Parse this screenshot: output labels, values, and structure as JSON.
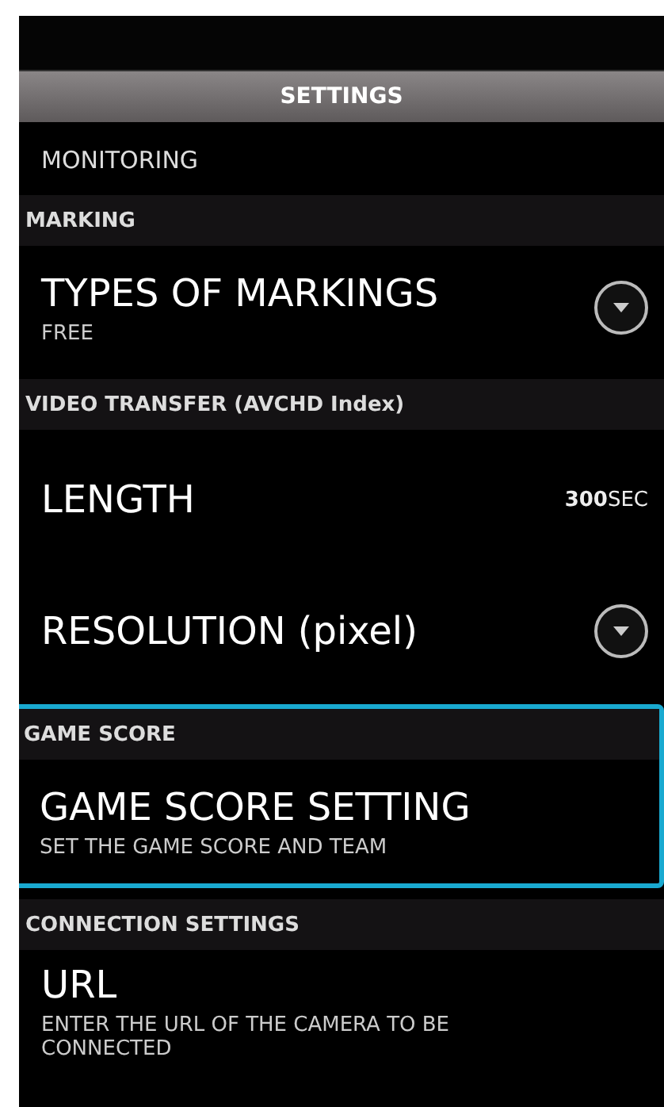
{
  "header": {
    "title": "SETTINGS"
  },
  "overflow_text": "MONITORING",
  "sections": [
    {
      "title": "MARKING",
      "highlighted": false,
      "items": [
        {
          "kind": "dropdown",
          "label": "TYPES OF MARKINGS",
          "subtitle": "FREE"
        }
      ]
    },
    {
      "title": "VIDEO TRANSFER (AVCHD Index)",
      "highlighted": false,
      "items": [
        {
          "kind": "value",
          "label": "LENGTH",
          "value": "**300**SEC"
        },
        {
          "kind": "dropdown",
          "label": "RESOLUTION (pixel)"
        }
      ]
    },
    {
      "title": "GAME SCORE",
      "highlighted": true,
      "items": [
        {
          "kind": "plain",
          "label": "GAME SCORE SETTING",
          "subtitle": "SET THE GAME SCORE AND TEAM"
        }
      ]
    },
    {
      "title": "CONNECTION SETTINGS",
      "highlighted": false,
      "items": [
        {
          "kind": "plain",
          "label": "URL",
          "subtitle": "ENTER THE URL OF THE CAMERA TO BE CONNECTED"
        }
      ]
    }
  ]
}
